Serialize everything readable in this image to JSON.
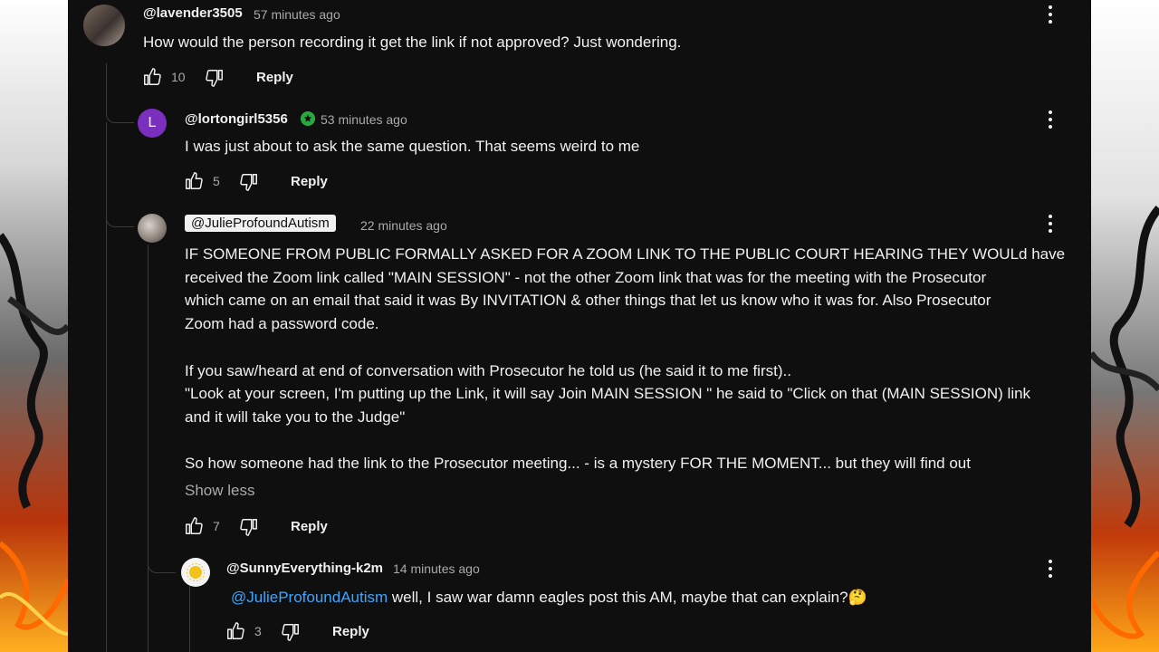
{
  "colors": {
    "background": "#0f0f0f",
    "text_primary": "#f1f1f1",
    "text_secondary": "#aaaaaa",
    "mention": "#3ea6ff",
    "avatar_L": "#7b2fbf",
    "verified_badge": "#2ba640"
  },
  "comments": [
    {
      "handle": "@lavender3505",
      "time": "57 minutes ago",
      "text": "How would the person recording it get the link if not approved? Just wondering.",
      "likes": "10",
      "reply_label": "Reply"
    },
    {
      "avatar_letter": "L",
      "handle": "@lortongirl5356",
      "time": "53 minutes ago",
      "text": "I was just about to ask the same question. That seems weird to me",
      "likes": "5",
      "reply_label": "Reply"
    },
    {
      "handle": "@JulieProfoundAutism",
      "time": "22 minutes ago",
      "lines": [
        "IF SOMEONE FROM PUBLIC FORMALLY ASKED FOR A ZOOM LINK TO THE PUBLIC COURT HEARING THEY WOULd have",
        "received the Zoom link called \"MAIN SESSION\"  - not the other Zoom link that was for the meeting with the Prosecutor",
        "which came on an email that said it was By INVITATION & other things that let us know who it was for. Also Prosecutor",
        "Zoom had a password code.",
        "",
        "If you saw/heard at end of conversation with Prosecutor he told us (he said it to me first)..",
        "\"Look at your screen, I'm putting up the Link, it will say Join MAIN SESSION \"  he said to \"Click on that (MAIN SESSION) link",
        "and it will take you to the Judge\"",
        "",
        "So how someone had the link to the Prosecutor meeting... - is a mystery FOR THE MOMENT... but they will find out"
      ],
      "show_less": "Show less",
      "likes": "7",
      "reply_label": "Reply"
    },
    {
      "handle": "@SunnyEverything-k2m",
      "time": "14 minutes ago",
      "mention": "@JulieProfoundAutism",
      "text": " well, I saw war damn eagles post this AM, maybe that can explain?",
      "emoji": "🤔",
      "likes": "3",
      "reply_label": "Reply"
    }
  ],
  "icons": [
    "like-icon",
    "dislike-icon",
    "more-options-icon",
    "verified-badge-icon"
  ]
}
